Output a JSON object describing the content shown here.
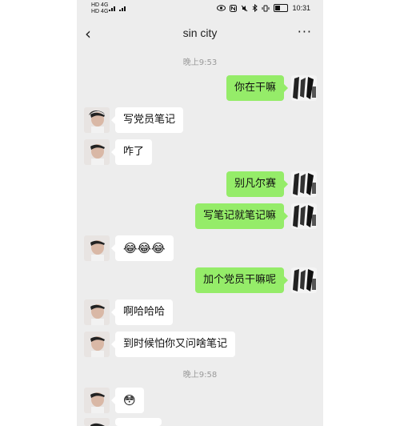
{
  "statusbar": {
    "left_top": "HD 4G",
    "left_bottom": "HD 4G",
    "signal": "ᴴᴰ .ıll .ıll",
    "icons": [
      "eye-icon",
      "nfc-icon",
      "mute-icon",
      "bluetooth-icon",
      "vibrate-icon"
    ],
    "battery": "battery-icon",
    "clock": "10:31"
  },
  "header": {
    "back_icon": "‹",
    "title": "sin  city",
    "more_icon": "···"
  },
  "chat": {
    "time1": "晚上9:53",
    "time2": "晚上9:58",
    "messages": [
      {
        "side": "out",
        "text": "你在干嘛"
      },
      {
        "side": "in",
        "text": "写党员笔记"
      },
      {
        "side": "in",
        "text": "咋了"
      },
      {
        "side": "out",
        "text": "别凡尔赛"
      },
      {
        "side": "out",
        "text": "写笔记就笔记嘛"
      },
      {
        "side": "in",
        "text": "😂😂😂"
      },
      {
        "side": "out",
        "text": "加个党员干嘛呢"
      },
      {
        "side": "in",
        "text": "啊哈哈哈"
      },
      {
        "side": "in",
        "text": "到时候怕你又问啥笔记"
      },
      {
        "side": "in",
        "text": "😳"
      }
    ]
  },
  "colors": {
    "background": "#ededed",
    "outgoing": "#95ec69",
    "incoming": "#ffffff"
  }
}
